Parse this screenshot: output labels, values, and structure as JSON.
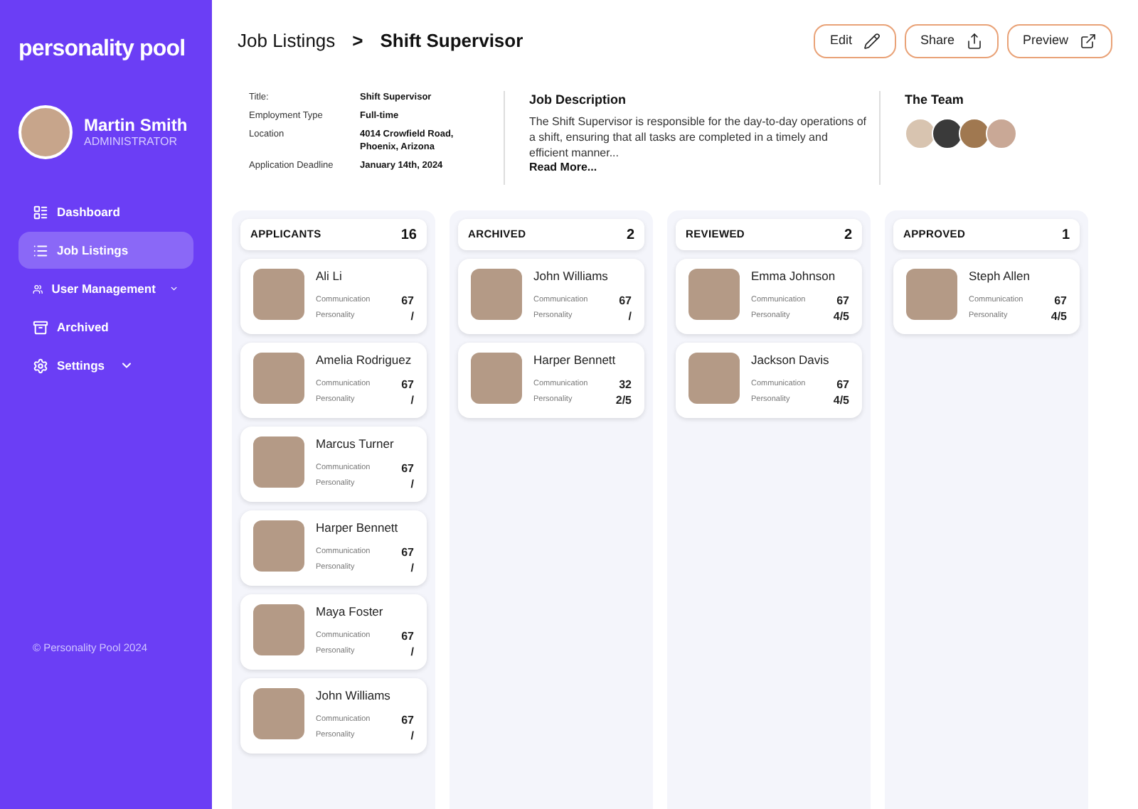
{
  "sidebar": {
    "logo": "personality pool",
    "user": {
      "name": "Martin Smith",
      "role": "ADMINISTRATOR"
    },
    "items": [
      {
        "label": "Dashboard",
        "kind": "dashboard",
        "selected": false,
        "has_submenu": false
      },
      {
        "label": "Job Listings",
        "kind": "list",
        "selected": true,
        "has_submenu": false
      },
      {
        "label": "User Management",
        "kind": "users",
        "selected": false,
        "has_submenu": true
      },
      {
        "label": "Archived",
        "kind": "archive",
        "selected": false,
        "has_submenu": false
      },
      {
        "label": "Settings",
        "kind": "settings",
        "selected": false,
        "has_submenu": true
      }
    ],
    "footer": "© Personality Pool 2024"
  },
  "breadcrumb": {
    "parent": "Job Listings",
    "separator": ">",
    "current": "Shift Supervisor"
  },
  "actions": [
    {
      "label": "Edit",
      "kind": "edit"
    },
    {
      "label": "Share",
      "kind": "share"
    },
    {
      "label": "Preview",
      "kind": "preview"
    }
  ],
  "details": [
    {
      "label": "Title:",
      "value": "Shift Supervisor"
    },
    {
      "label": "Employment Type",
      "value": "Full-time"
    },
    {
      "label": "Location",
      "value": "4014 Crowfield Road, Phoenix, Arizona"
    },
    {
      "label": "Application Deadline",
      "value": "January 14th, 2024"
    }
  ],
  "description": {
    "title": "Job Description",
    "text": "The Shift Supervisor is responsible for the day-to-day operations of a shift, ensuring that all tasks are completed in a timely and efficient manner...",
    "link": "Read More..."
  },
  "team": {
    "title": "The Team"
  },
  "columns": [
    {
      "title": "APPLICANTS",
      "count": "16",
      "cards": [
        {
          "name": "Ali Li",
          "communication_label": "Communication",
          "communication": "67",
          "personality_label": "Personality",
          "personality": "/"
        },
        {
          "name": "Amelia Rodriguez",
          "communication_label": "Communication",
          "communication": "67",
          "personality_label": "Personality",
          "personality": "/"
        },
        {
          "name": "Marcus Turner",
          "communication_label": "Communication",
          "communication": "67",
          "personality_label": "Personality",
          "personality": "/"
        },
        {
          "name": "Harper Bennett",
          "communication_label": "Communication",
          "communication": "67",
          "personality_label": "Personality",
          "personality": "/"
        },
        {
          "name": "Maya Foster",
          "communication_label": "Communication",
          "communication": "67",
          "personality_label": "Personality",
          "personality": "/"
        },
        {
          "name": "John Williams",
          "communication_label": "Communication",
          "communication": "67",
          "personality_label": "Personality",
          "personality": "/"
        }
      ]
    },
    {
      "title": "ARCHIVED",
      "count": "2",
      "cards": [
        {
          "name": "John Williams",
          "communication_label": "Communication",
          "communication": "67",
          "personality_label": "Personality",
          "personality": "/"
        },
        {
          "name": "Harper Bennett",
          "communication_label": "Communication",
          "communication": "32",
          "personality_label": "Personality",
          "personality": "2/5"
        }
      ]
    },
    {
      "title": "REVIEWED",
      "count": "2",
      "cards": [
        {
          "name": "Emma Johnson",
          "communication_label": "Communication",
          "communication": "67",
          "personality_label": "Personality",
          "personality": "4/5"
        },
        {
          "name": "Jackson Davis",
          "communication_label": "Communication",
          "communication": "67",
          "personality_label": "Personality",
          "personality": "4/5"
        }
      ]
    },
    {
      "title": "APPROVED",
      "count": "1",
      "cards": [
        {
          "name": "Steph Allen",
          "communication_label": "Communication",
          "communication": "67",
          "personality_label": "Personality",
          "personality": "4/5"
        }
      ]
    }
  ]
}
